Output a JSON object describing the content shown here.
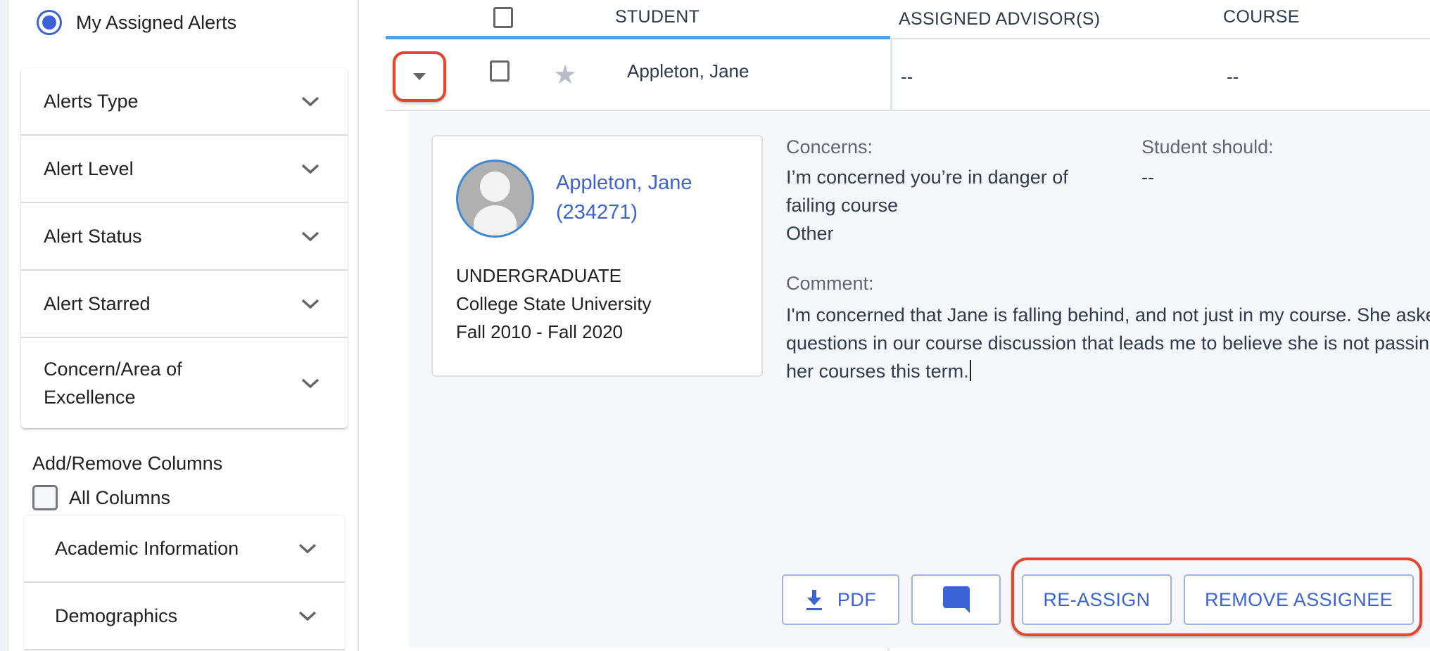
{
  "sidebar": {
    "radio_label": "My Assigned Alerts",
    "filters": [
      {
        "label": "Alerts Type"
      },
      {
        "label": "Alert Level"
      },
      {
        "label": "Alert Status"
      },
      {
        "label": "Alert Starred"
      },
      {
        "label": "Concern/Area of Excellence"
      }
    ],
    "columns_title": "Add/Remove Columns",
    "all_columns_label": "All Columns",
    "column_groups": [
      {
        "label": "Academic Information"
      },
      {
        "label": "Demographics"
      }
    ]
  },
  "table": {
    "headers": {
      "student": "STUDENT",
      "advisors": "ASSIGNED ADVISOR(S)",
      "course": "COURSE"
    },
    "row": {
      "student": "Appleton, Jane",
      "advisors": "--",
      "course": "--"
    }
  },
  "details": {
    "student_link": "Appleton, Jane (234271)",
    "level": "UNDERGRADUATE",
    "institution": "College State University",
    "term_range": "Fall 2010 - Fall 2020",
    "concerns_label": "Concerns:",
    "concerns": [
      "I’m concerned you’re in danger of failing course",
      "Other"
    ],
    "student_should_label": "Student should:",
    "student_should": "--",
    "comment_label": "Comment:",
    "comment": "I'm concerned that Jane is falling behind, and not just in my course. She asked questions in our course discussion that leads me to believe she is not passing her courses this term."
  },
  "actions": {
    "pdf_label": "PDF",
    "reassign_label": "RE-ASSIGN",
    "remove_label": "REMOVE ASSIGNEE"
  },
  "colors": {
    "accent": "#3b63d6",
    "highlight": "#e5452c",
    "tab_underline": "#4aa3f0"
  }
}
